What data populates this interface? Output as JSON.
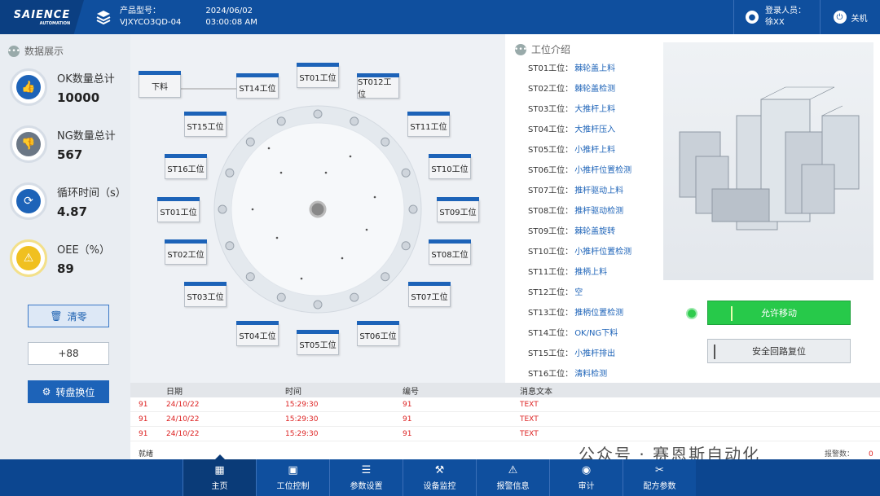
{
  "header": {
    "logo": "SAIENCE",
    "logo_sub": "AUTOMATION",
    "product_label": "产品型号：",
    "product_code": "VJXYCO3QD-04",
    "date": "2024/06/02",
    "time": "03:00:08 AM",
    "login_label": "登录人员：",
    "login_user": "徐XX",
    "power_label": "关机"
  },
  "left": {
    "section_title": "数据展示",
    "stats": [
      {
        "label": "OK数量总计",
        "value": "10000",
        "color": "#1d63b8",
        "icon": "thumbs-up-icon"
      },
      {
        "label": "NG数量总计",
        "value": "567",
        "color": "#6b7785",
        "icon": "thumbs-down-icon"
      },
      {
        "label": "循环时间（s）",
        "value": "4.87",
        "color": "#1d63b8",
        "icon": "refresh-icon"
      },
      {
        "label": "OEE（%）",
        "value": "89",
        "color": "#f0c020",
        "icon": "warning-icon"
      }
    ],
    "clear_button": "清零",
    "counter_value": "+88",
    "rotate_button": "转盘换位"
  },
  "center": {
    "xialiao": "下料",
    "stations": [
      "ST01工位",
      "ST012工位",
      "ST11工位",
      "ST10工位",
      "ST09工位",
      "ST08工位",
      "ST07工位",
      "ST06工位",
      "ST05工位",
      "ST04工位",
      "ST03工位",
      "ST02工位",
      "ST01工位",
      "ST16工位",
      "ST15工位",
      "ST14工位"
    ]
  },
  "middle": {
    "section_title": "工位介绍",
    "list": [
      {
        "label": "ST01工位：",
        "value": "棘轮盖上料"
      },
      {
        "label": "ST02工位：",
        "value": "棘轮盖检测"
      },
      {
        "label": "ST03工位：",
        "value": "大推杆上料"
      },
      {
        "label": "ST04工位：",
        "value": "大推杆压入"
      },
      {
        "label": "ST05工位：",
        "value": "小推杆上料"
      },
      {
        "label": "ST06工位：",
        "value": "小推杆位置检测"
      },
      {
        "label": "ST07工位：",
        "value": "推杆驱动上料"
      },
      {
        "label": "ST08工位：",
        "value": "推杆驱动检测"
      },
      {
        "label": "ST09工位：",
        "value": "棘轮盖旋转"
      },
      {
        "label": "ST10工位：",
        "value": "小推杆位置检测"
      },
      {
        "label": "ST11工位：",
        "value": "推柄上料"
      },
      {
        "label": "ST12工位：",
        "value": "空"
      },
      {
        "label": "ST13工位：",
        "value": "推柄位置检测"
      },
      {
        "label": "ST14工位：",
        "value": "OK/NG下料"
      },
      {
        "label": "ST15工位：",
        "value": "小推杆排出"
      },
      {
        "label": "ST16工位：",
        "value": "清料检测"
      }
    ]
  },
  "right": {
    "allow_move": "允许移动",
    "safety_reset": "安全回路复位"
  },
  "table": {
    "headers": [
      "日期",
      "时间",
      "编号",
      "消息文本"
    ],
    "rows": [
      [
        "91",
        "24/10/22",
        "15:29:30",
        "91",
        "TEXT"
      ],
      [
        "91",
        "24/10/22",
        "15:29:30",
        "91",
        "TEXT"
      ],
      [
        "91",
        "24/10/22",
        "15:29:30",
        "91",
        "TEXT"
      ]
    ],
    "status": "就绪",
    "alarm_label": "报警数：",
    "alarm_count": "0"
  },
  "watermark": "公众号 · 赛恩斯自动化",
  "nav": [
    {
      "label": "主页",
      "icon": "home-grid-icon"
    },
    {
      "label": "工位控制",
      "icon": "monitor-icon"
    },
    {
      "label": "参数设置",
      "icon": "sliders-icon"
    },
    {
      "label": "设备监控",
      "icon": "robot-arm-icon"
    },
    {
      "label": "报警信息",
      "icon": "alarm-icon"
    },
    {
      "label": "审计",
      "icon": "audit-icon"
    },
    {
      "label": "配方参数",
      "icon": "tools-icon"
    }
  ]
}
